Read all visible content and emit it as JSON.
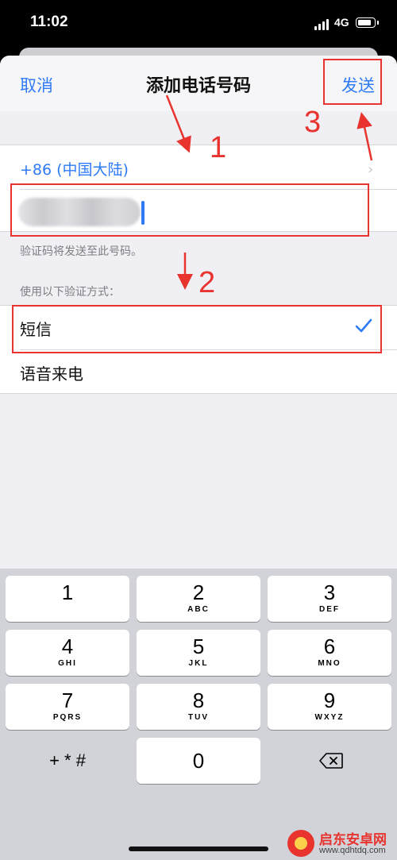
{
  "status": {
    "time": "11:02",
    "network": "4G"
  },
  "nav": {
    "cancel": "取消",
    "title": "添加电话号码",
    "send": "发送"
  },
  "form": {
    "country": "+86 (中国大陆)",
    "phone_placeholder": "",
    "hint": "验证码将发送至此号码。",
    "method_title": "使用以下验证方式：",
    "options": [
      {
        "label": "短信",
        "selected": true
      },
      {
        "label": "语音来电",
        "selected": false
      }
    ]
  },
  "annotations": {
    "step1": "1",
    "step2": "2",
    "step3": "3",
    "color": "#e8332e"
  },
  "keypad": {
    "keys": [
      {
        "digit": "1",
        "letters": ""
      },
      {
        "digit": "2",
        "letters": "ABC"
      },
      {
        "digit": "3",
        "letters": "DEF"
      },
      {
        "digit": "4",
        "letters": "GHI"
      },
      {
        "digit": "5",
        "letters": "JKL"
      },
      {
        "digit": "6",
        "letters": "MNO"
      },
      {
        "digit": "7",
        "letters": "PQRS"
      },
      {
        "digit": "8",
        "letters": "TUV"
      },
      {
        "digit": "9",
        "letters": "WXYZ"
      },
      {
        "digit": "0",
        "letters": ""
      }
    ],
    "symbols": "+ * #"
  },
  "icons": [
    "signal-icon",
    "battery-icon",
    "chevron-right-icon",
    "checkmark-icon",
    "delete-backspace-icon"
  ],
  "colors": {
    "accent": "#2f7bf6",
    "annotation": "#e8332e",
    "sheet_bg": "#efeff4",
    "keyboard_bg": "#d1d3d9"
  },
  "watermark": {
    "title": "启东安卓网",
    "url": "www.qdhtdq.com"
  }
}
